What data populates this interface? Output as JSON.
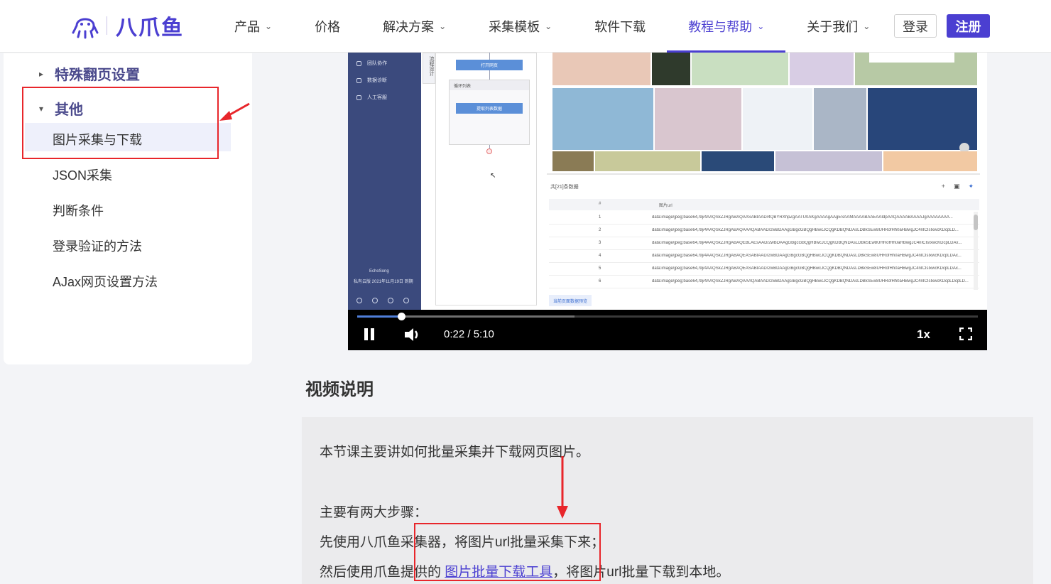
{
  "header": {
    "logo_text": "八爪鱼",
    "nav": [
      {
        "label": "产品",
        "dropdown": true
      },
      {
        "label": "价格",
        "dropdown": false
      },
      {
        "label": "解决方案",
        "dropdown": true
      },
      {
        "label": "采集模板",
        "dropdown": true
      },
      {
        "label": "软件下载",
        "dropdown": false
      },
      {
        "label": "教程与帮助",
        "dropdown": true,
        "active": true
      },
      {
        "label": "关于我们",
        "dropdown": true
      }
    ],
    "login_label": "登录",
    "register_label": "注册",
    "accent_color": "#4b3fd1"
  },
  "sidebar": {
    "section_collapsed": "特殊翻页设置",
    "section_expanded": "其他",
    "items": [
      "图片采集与下载",
      "JSON采集",
      "判断条件",
      "登录验证的方法",
      "AJax网页设置方法"
    ],
    "active_item": "图片采集与下载"
  },
  "video": {
    "app_sidebar": [
      "团队协作",
      "数据诊断",
      "人工客服"
    ],
    "side_tab": "流程设计",
    "flow": {
      "open_page": "打开网页",
      "loop": "循环列表",
      "extract": "提取列表数据"
    },
    "user": {
      "name": "EchoSong",
      "plan": "私有云版  2021年11月19日 到期"
    },
    "table": {
      "count_label": "共[21]条数据",
      "col_index": "#",
      "col_url": "图片url",
      "rows": [
        {
          "n": "1",
          "url": "data:image/jpeg;base64,/9j/4AAQSkZJRgABAQAASABIAAD/4QBYRXhpZgAATU0AKgAAAAgAAgESAAMAAAABAAEAAIdpAAQAAAABAAAAJgAAAAAAAA..."
        },
        {
          "n": "2",
          "url": "data:image/jpeg;base64,/9j/4AAQSkZJRgABAQAAAQABAAD/2wBDAAgGBgcGBQgHBwcJCQgKDBQNDAsLDBkSEw8UHRofHh0aHBwgJC4nICIsIxwcKDcpLD..."
        },
        {
          "n": "3",
          "url": "data:image/jpeg;base64,/9j/4AAQSkZJRgABAQEBLAEsAAD/2wBDAAgGBgcGBQgHBwcJCQgKDBQNDAsLDBkSEw8UHRofHh0aHBwgJC4nICIsIxwcKDcpLDAx..."
        },
        {
          "n": "4",
          "url": "data:image/jpeg;base64,/9j/4AAQSkZJRgABAQEASABIAAD/2wBDAAgGBgcGBQgHBwcJCQgKDBQNDAsLDBkSEw8UHRofHh0aHBwgJC4nICIsIxwcKDcpLDAx..."
        },
        {
          "n": "5",
          "url": "data:image/jpeg;base64,/9j/4AAQSkZJRgABAQEASABIAAD/2wBDAAgGBgcGBQgHBwcJCQgKDBQNDAsLDBkSEw8UHRofHh0aHBwgJC4nICIsIxwcKDcpLDAx..."
        },
        {
          "n": "6",
          "url": "data:image/jpeg;base64,/9j/4AAQSkZJRgABAQAAAQABAAD/2wBDAAgGBgcGBQgHBwcJCQgKDBQNDAsLDBkSEw8UHRofHh0aHBwgJC4nICIsIxwcKDcpLDcpLD..."
        }
      ],
      "preview_label": "当前页面数据预览"
    },
    "controls": {
      "time": "0:22 / 5:10",
      "speed": "1x",
      "progress": 0.071,
      "buffered": 0.35
    }
  },
  "description": {
    "title": "视频说明",
    "line1": "本节课主要讲如何批量采集并下载网页图片。",
    "line2": "主要有两大步骤：",
    "line3": "先使用八爪鱼采集器，将图片url批量采集下来；",
    "line4_pre": "然后使用爪鱼提供的 ",
    "line4_link": "图片批量下载工具",
    "line4_post": "，将图片url批量下载到本地。"
  },
  "annotation_color": "#e8262b"
}
